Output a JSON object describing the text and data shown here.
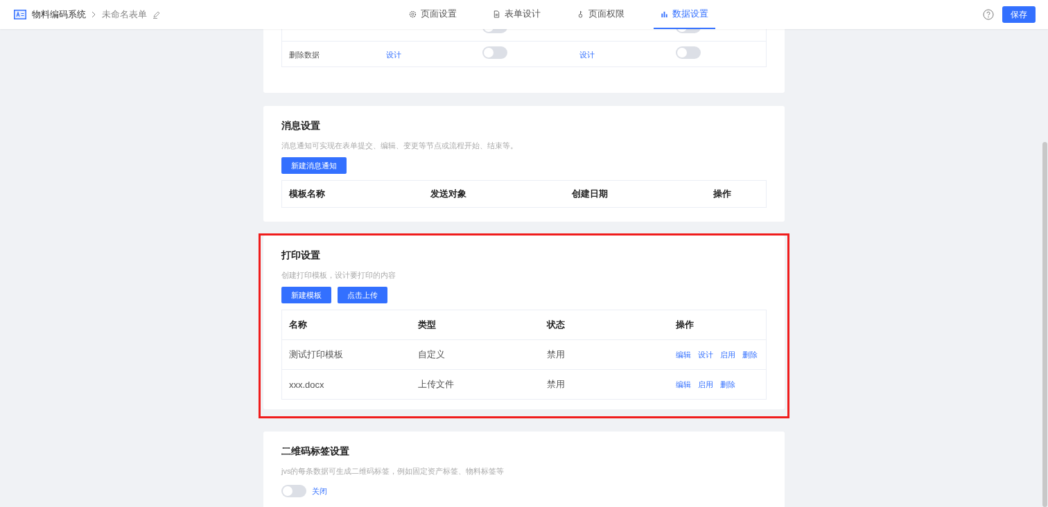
{
  "header": {
    "app_name": "物料编码系统",
    "form_name": "未命名表单",
    "tabs": [
      {
        "label": "页面设置",
        "kind": "gear",
        "selected": false
      },
      {
        "label": "表单设计",
        "kind": "document",
        "selected": false
      },
      {
        "label": "页面权限",
        "kind": "key",
        "selected": false
      },
      {
        "label": "数据设置",
        "kind": "chart",
        "selected": true
      }
    ],
    "save_button": "保存"
  },
  "data_permissions": {
    "rows": [
      {
        "enabled_1": false,
        "enabled_2": false
      },
      {
        "name": "删除数据",
        "link_1": "设计",
        "enabled_1": false,
        "link_2": "设计",
        "enabled_2": false
      }
    ]
  },
  "message_settings": {
    "title": "消息设置",
    "description": "消息通知可实现在表单提交、编辑、变更等节点或流程开始、结束等。",
    "button": "新建消息通知",
    "columns": [
      "模板名称",
      "发送对象",
      "创建日期",
      "操作"
    ]
  },
  "print_settings": {
    "highlighted": true,
    "title": "打印设置",
    "description": "创建打印模板，设计要打印的内容",
    "buttons": [
      "新建模板",
      "点击上传"
    ],
    "columns": [
      "名称",
      "类型",
      "状态",
      "操作"
    ],
    "rows": [
      {
        "cells": [
          "测试打印模板",
          "自定义",
          "禁用"
        ],
        "actions": [
          "编辑",
          "设计",
          "启用",
          "删除"
        ]
      },
      {
        "cells": [
          "xxx.docx",
          "上传文件",
          "禁用"
        ],
        "actions": [
          "编辑",
          "启用",
          "删除"
        ]
      }
    ]
  },
  "qr_settings": {
    "title": "二维码标签设置",
    "description": "jvs的每条数据可生成二维码标签，例如固定资产标签、物料标签等",
    "switch": {
      "on": false,
      "label": "关闭"
    }
  }
}
